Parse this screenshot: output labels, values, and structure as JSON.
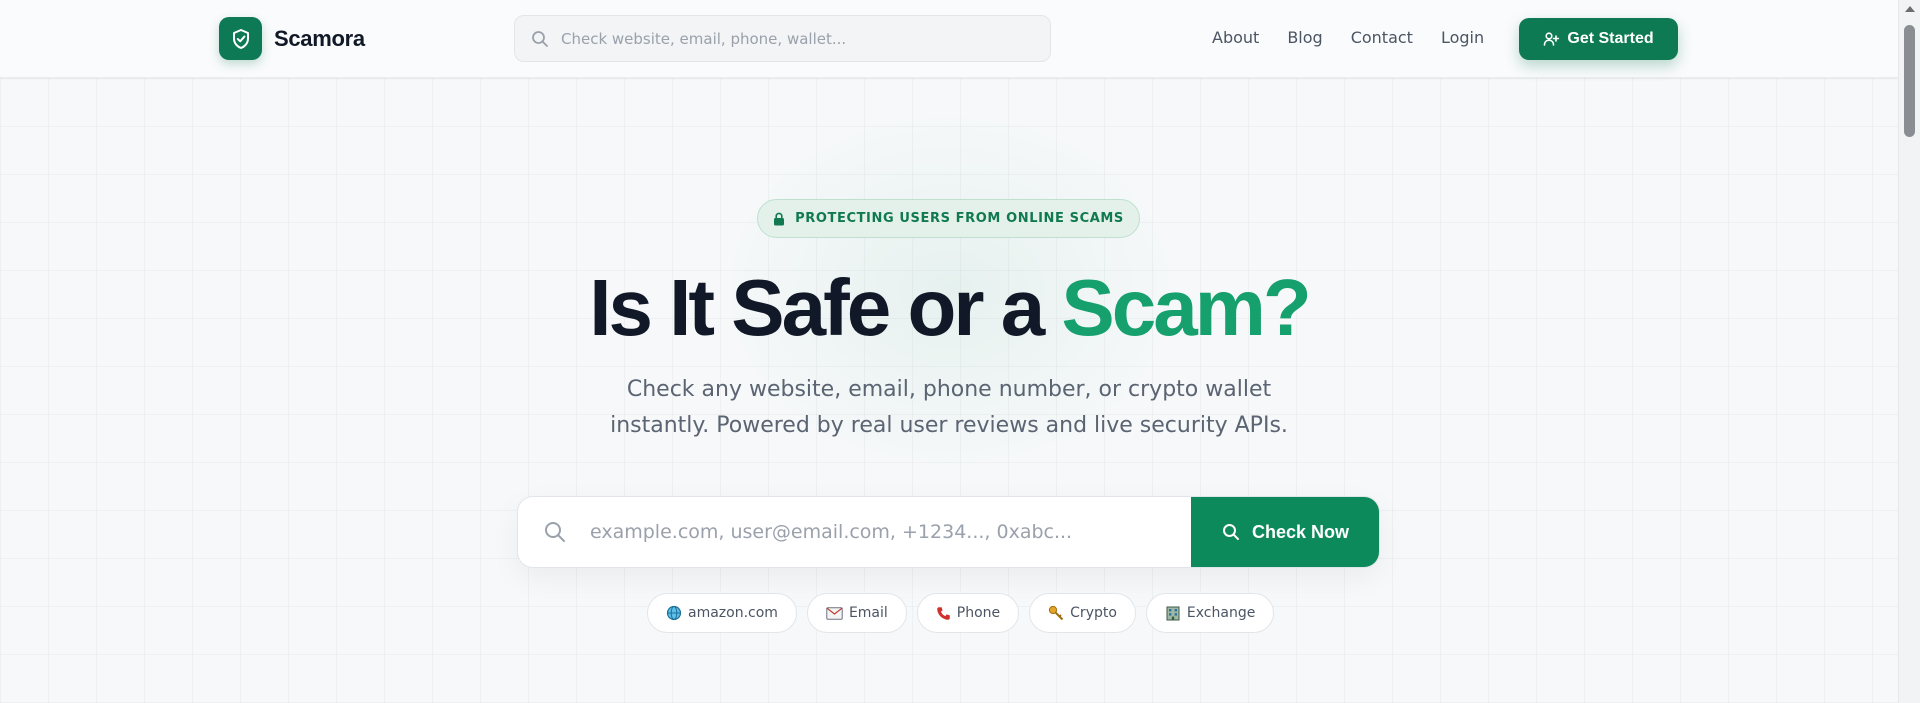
{
  "brand": {
    "name": "Scamora"
  },
  "nav": {
    "search_placeholder": "Check website, email, phone, wallet...",
    "links": [
      "About",
      "Blog",
      "Contact",
      "Login"
    ],
    "cta_label": "Get Started"
  },
  "hero": {
    "badge": "PROTECTING USERS FROM ONLINE SCAMS",
    "title_main": "Is It Safe or a",
    "title_accent": "Scam?",
    "subtitle_line1": "Check any website, email, phone number, or crypto wallet",
    "subtitle_line2": "instantly. Powered by real user reviews and live security APIs."
  },
  "search": {
    "placeholder": "example.com, user@email.com, +1234..., 0xabc...",
    "button_label": "Check Now"
  },
  "chips": [
    {
      "label": "amazon.com",
      "icon": "globe-icon"
    },
    {
      "label": "Email",
      "icon": "email-icon"
    },
    {
      "label": "Phone",
      "icon": "phone-icon"
    },
    {
      "label": "Crypto",
      "icon": "key-icon"
    },
    {
      "label": "Exchange",
      "icon": "bank-icon"
    }
  ],
  "colors": {
    "brand": "#0d7a54",
    "accent": "#16a06e",
    "badge_bg": "#e3f1ea",
    "text_dark": "#111827",
    "text_muted": "#5b6472"
  }
}
